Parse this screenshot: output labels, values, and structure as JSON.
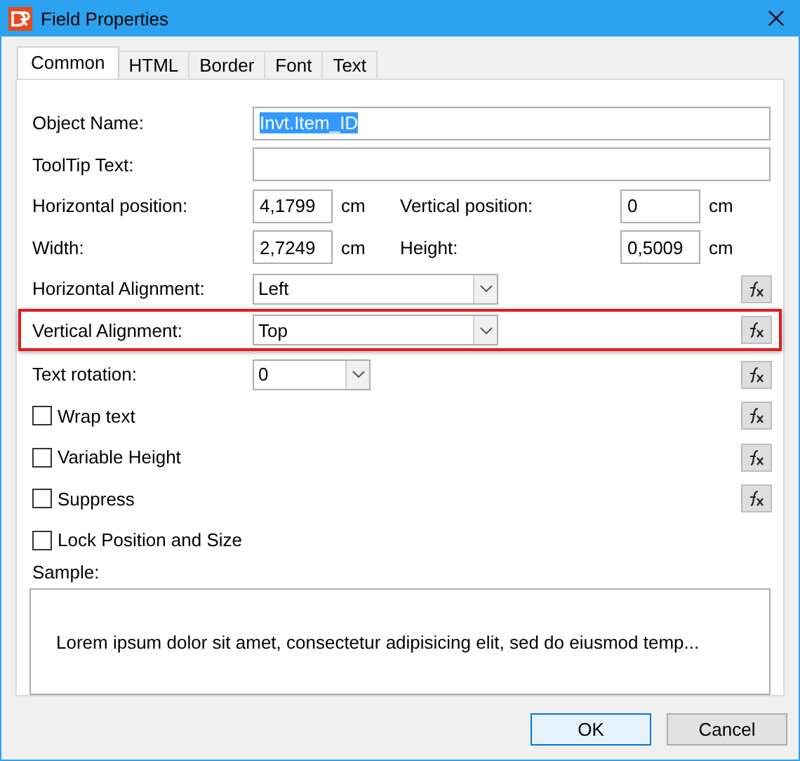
{
  "window": {
    "title": "Field Properties"
  },
  "tabs": [
    {
      "label": "Common",
      "selected": true
    },
    {
      "label": "HTML",
      "selected": false
    },
    {
      "label": "Border",
      "selected": false
    },
    {
      "label": "Font",
      "selected": false
    },
    {
      "label": "Text",
      "selected": false
    }
  ],
  "fields": [
    {
      "kind": "text",
      "label": "Object Name:",
      "value": "Invt.Item_ID",
      "text_selected": true
    },
    {
      "kind": "text",
      "label": "ToolTip Text:"
    },
    {
      "kind": "pair",
      "items": [
        {
          "label": "Horizontal position:",
          "value": "4,1799",
          "unit": "cm"
        },
        {
          "label": "Vertical position:",
          "value": "0",
          "unit": "cm"
        }
      ]
    },
    {
      "kind": "pair",
      "items": [
        {
          "label": "Width:",
          "value": "2,7249",
          "unit": "cm"
        },
        {
          "label": "Height:",
          "value": "0,5009",
          "unit": "cm"
        }
      ]
    },
    {
      "kind": "dropdown",
      "label": "Horizontal Alignment:",
      "value": "Left",
      "formula": true,
      "highlighted": false
    },
    {
      "kind": "dropdown",
      "label": "Vertical Alignment:",
      "value": "Top",
      "formula": true,
      "highlighted": true
    },
    {
      "kind": "combo",
      "label": "Text rotation:",
      "value": "0",
      "formula": true,
      "highlighted": false
    },
    {
      "kind": "checkbox",
      "label": "Wrap text",
      "checked": false,
      "formula": true
    },
    {
      "kind": "checkbox",
      "label": "Variable Height",
      "checked": false,
      "formula": true
    },
    {
      "kind": "checkbox",
      "label": "Suppress",
      "checked": false,
      "formula": true
    },
    {
      "kind": "checkbox",
      "label": "Lock Position and Size",
      "checked": false,
      "formula": false
    }
  ],
  "sample": {
    "label": "Sample:",
    "text": "Lorem ipsum dolor sit amet, consectetur adipisicing elit, sed do eiusmod temp..."
  },
  "buttons": [
    {
      "label": "OK",
      "default": true
    },
    {
      "label": "Cancel",
      "default": false
    }
  ]
}
